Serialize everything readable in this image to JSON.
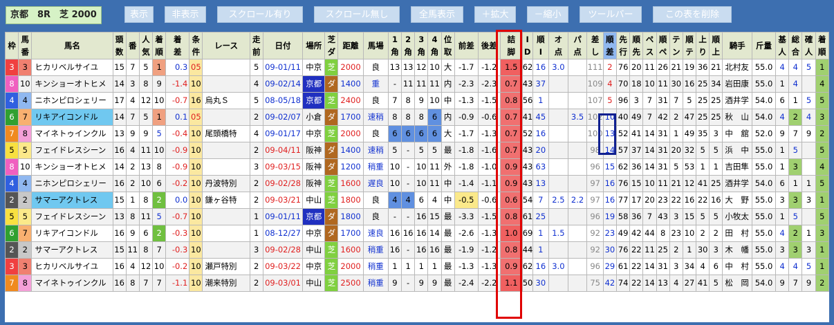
{
  "toolbar": {
    "race_label": "京都　8R　芝 2000",
    "buttons": [
      {
        "label": "表示"
      },
      {
        "label": "非表示"
      },
      {
        "label": "スクロール有り"
      },
      {
        "label": "スクロール無し"
      },
      {
        "label": "全馬表示"
      },
      {
        "label": "＋拡大"
      },
      {
        "label": "－縮小"
      },
      {
        "label": "ツールバー"
      },
      {
        "label": "この表を削除"
      }
    ]
  },
  "headers": [
    "枠",
    "馬番",
    "馬名",
    "頭数",
    "番",
    "人気",
    "着順",
    "着差",
    "条件",
    "レース",
    "走前",
    "日付",
    "場所",
    "芝ダ",
    "距離",
    "馬場",
    "1角",
    "2角",
    "3角",
    "4角",
    "位取",
    "前差",
    "後差",
    "詰脚",
    "ID",
    "順I",
    "オ点",
    "パ点",
    "差し",
    "順差",
    "先行",
    "順先",
    "ペス",
    "順ペ",
    "テン",
    "順テ",
    "上り",
    "順上",
    "騎手",
    "斤量",
    "基人",
    "総合",
    "確人",
    "着順"
  ],
  "rows": [
    [
      "3",
      "3",
      "ヒカリベルサイユ",
      "15",
      "7",
      "5",
      "1",
      "0.3",
      "05",
      "",
      "5",
      "09-01/11",
      "中京",
      "芝",
      "2000",
      "良",
      "13",
      "13",
      "12",
      "10",
      "大",
      "-1.7",
      "-1.2",
      "1.5",
      "62",
      "16",
      "3.0",
      "",
      "111",
      "2",
      "76",
      "20",
      "11",
      "26",
      "21",
      "19",
      "36",
      "21",
      "北村友",
      "55.0",
      "4",
      "4",
      "5",
      "1"
    ],
    [
      "8",
      "10",
      "キンショーオトヒメ",
      "14",
      "3",
      "8",
      "9",
      "-1.4",
      "10",
      "",
      "4",
      "09-02/14",
      "京都",
      "ダ",
      "1400",
      "重",
      "-",
      "11",
      "11",
      "11",
      "内",
      "-2.3",
      "-2.3",
      "0.7",
      "43",
      "37",
      "",
      "",
      "109",
      "4",
      "70",
      "18",
      "10",
      "11",
      "30",
      "16",
      "25",
      "34",
      "岩田康",
      "55.0",
      "1",
      "4",
      "",
      "4"
    ],
    [
      "4",
      "4",
      "ニホンピロシェリー",
      "17",
      "4",
      "12",
      "10",
      "-0.7",
      "16",
      "烏丸Ｓ",
      "5",
      "08-05/18",
      "京都",
      "芝",
      "2400",
      "良",
      "7",
      "8",
      "9",
      "10",
      "中",
      "-1.3",
      "-1.5",
      "0.8",
      "56",
      "1",
      "",
      "",
      "107",
      "5",
      "96",
      "3",
      "7",
      "31",
      "7",
      "5",
      "25",
      "25",
      "酒井学",
      "54.0",
      "6",
      "1",
      "5",
      "5"
    ],
    [
      "6",
      "7",
      "リキアイコンドル",
      "14",
      "7",
      "5",
      "1",
      "0.1",
      "05",
      "",
      "2",
      "09-02/07",
      "小倉",
      "ダ",
      "1700",
      "速稍",
      "8",
      "8",
      "8",
      "6",
      "内",
      "-0.9",
      "-0.6",
      "0.7",
      "41",
      "45",
      "",
      "3.5",
      "102",
      "10",
      "40",
      "49",
      "7",
      "42",
      "2",
      "47",
      "25",
      "25",
      "秋　山",
      "54.0",
      "4",
      "2",
      "4",
      "3"
    ],
    [
      "7",
      "8",
      "マイネトゥインクル",
      "13",
      "9",
      "9",
      "5",
      "-0.4",
      "10",
      "尾頭橋特",
      "4",
      "09-01/17",
      "中京",
      "芝",
      "2000",
      "良",
      "6",
      "6",
      "6",
      "6",
      "大",
      "-1.7",
      "-1.3",
      "0.7",
      "52",
      "16",
      "",
      "",
      "100",
      "13",
      "52",
      "41",
      "14",
      "31",
      "1",
      "49",
      "35",
      "3",
      "中　舘",
      "52.0",
      "9",
      "7",
      "9",
      "2"
    ],
    [
      "5",
      "5",
      "フェイドレスシーン",
      "16",
      "4",
      "11",
      "10",
      "-0.9",
      "10",
      "",
      "2",
      "09-04/11",
      "阪神",
      "ダ",
      "1400",
      "速稍",
      "5",
      "-",
      "5",
      "5",
      "最",
      "-1.8",
      "-1.6",
      "0.7",
      "43",
      "20",
      "",
      "",
      "98",
      "14",
      "57",
      "37",
      "14",
      "31",
      "20",
      "32",
      "5",
      "5",
      "浜　中",
      "55.0",
      "1",
      "5",
      "",
      "5"
    ],
    [
      "8",
      "10",
      "キンショーオトヒメ",
      "14",
      "2",
      "13",
      "8",
      "-0.9",
      "10",
      "",
      "3",
      "09-03/15",
      "阪神",
      "ダ",
      "1200",
      "稍重",
      "10",
      "-",
      "10",
      "11",
      "外",
      "-1.8",
      "-1.0",
      "0.9",
      "43",
      "63",
      "",
      "",
      "96",
      "15",
      "62",
      "36",
      "14",
      "31",
      "5",
      "53",
      "1",
      "1",
      "吉田隼",
      "55.0",
      "1",
      "3",
      "",
      "4"
    ],
    [
      "4",
      "4",
      "ニホンピロシェリー",
      "16",
      "2",
      "10",
      "6",
      "-0.2",
      "10",
      "丹波特別",
      "2",
      "09-02/28",
      "阪神",
      "芝",
      "1600",
      "遅良",
      "10",
      "-",
      "10",
      "11",
      "中",
      "-1.4",
      "-1.1",
      "0.9",
      "43",
      "13",
      "",
      "",
      "97",
      "16",
      "76",
      "15",
      "10",
      "11",
      "21",
      "12",
      "41",
      "25",
      "酒井学",
      "54.0",
      "6",
      "1",
      "1",
      "5"
    ],
    [
      "2",
      "2",
      "サマーアクトレス",
      "15",
      "1",
      "8",
      "2",
      "0.0",
      "10",
      "鎌ヶ谷特",
      "2",
      "09-03/21",
      "中山",
      "芝",
      "1800",
      "良",
      "4",
      "4",
      "6",
      "4",
      "中",
      "-0.5",
      "-0.6",
      "0.6",
      "54",
      "7",
      "2.5",
      "2.2",
      "97",
      "16",
      "77",
      "17",
      "20",
      "23",
      "22",
      "16",
      "22",
      "16",
      "大　野",
      "55.0",
      "3",
      "3",
      "3",
      "1"
    ],
    [
      "5",
      "5",
      "フェイドレスシーン",
      "13",
      "8",
      "11",
      "5",
      "-0.7",
      "10",
      "",
      "1",
      "09-01/11",
      "京都",
      "ダ",
      "1800",
      "良",
      "-",
      "-",
      "16",
      "15",
      "最",
      "-3.3",
      "-1.5",
      "0.8",
      "61",
      "25",
      "",
      "",
      "96",
      "19",
      "58",
      "36",
      "7",
      "43",
      "3",
      "15",
      "5",
      "5",
      "小牧太",
      "55.0",
      "1",
      "5",
      "",
      "5"
    ],
    [
      "6",
      "7",
      "リキアイコンドル",
      "16",
      "9",
      "6",
      "2",
      "-0.3",
      "10",
      "",
      "1",
      "08-12/27",
      "中京",
      "ダ",
      "1700",
      "速良",
      "16",
      "16",
      "16",
      "14",
      "最",
      "-2.6",
      "-1.3",
      "1.0",
      "69",
      "1",
      "1.5",
      "",
      "92",
      "23",
      "49",
      "42",
      "44",
      "8",
      "23",
      "10",
      "2",
      "2",
      "田　村",
      "55.0",
      "4",
      "2",
      "1",
      "3"
    ],
    [
      "2",
      "2",
      "サマーアクトレス",
      "15",
      "11",
      "8",
      "7",
      "-0.3",
      "10",
      "",
      "3",
      "09-02/28",
      "中山",
      "芝",
      "1600",
      "稍重",
      "16",
      "-",
      "16",
      "16",
      "最",
      "-1.9",
      "-1.2",
      "0.8",
      "44",
      "1",
      "",
      "",
      "92",
      "30",
      "76",
      "22",
      "11",
      "25",
      "2",
      "1",
      "30",
      "3",
      "木　幡",
      "55.0",
      "3",
      "3",
      "3",
      "1"
    ],
    [
      "3",
      "3",
      "ヒカリベルサイユ",
      "16",
      "4",
      "12",
      "10",
      "-0.2",
      "10",
      "瀬戸特別",
      "2",
      "09-03/22",
      "中京",
      "芝",
      "2000",
      "稍重",
      "1",
      "1",
      "1",
      "1",
      "最",
      "-1.3",
      "-1.3",
      "0.9",
      "62",
      "16",
      "3.0",
      "",
      "96",
      "29",
      "61",
      "22",
      "14",
      "31",
      "3",
      "34",
      "4",
      "6",
      "中　村",
      "55.0",
      "4",
      "4",
      "5",
      "1"
    ],
    [
      "7",
      "8",
      "マイネトゥインクル",
      "16",
      "8",
      "7",
      "7",
      "-1.1",
      "10",
      "潮来特別",
      "2",
      "09-03/01",
      "中山",
      "芝",
      "2500",
      "稍重",
      "9",
      "-",
      "9",
      "9",
      "最",
      "-2.4",
      "-2.2",
      "1.1",
      "50",
      "30",
      "",
      "",
      "75",
      "42",
      "74",
      "22",
      "14",
      "13",
      "4",
      "27",
      "41",
      "5",
      "松　岡",
      "54.0",
      "9",
      "7",
      "9",
      "2"
    ]
  ],
  "colors": {
    "background": "#3d6fb0",
    "header": "#e2e8cf",
    "highlight_box": "#e00000",
    "rank_box": "#102090"
  }
}
